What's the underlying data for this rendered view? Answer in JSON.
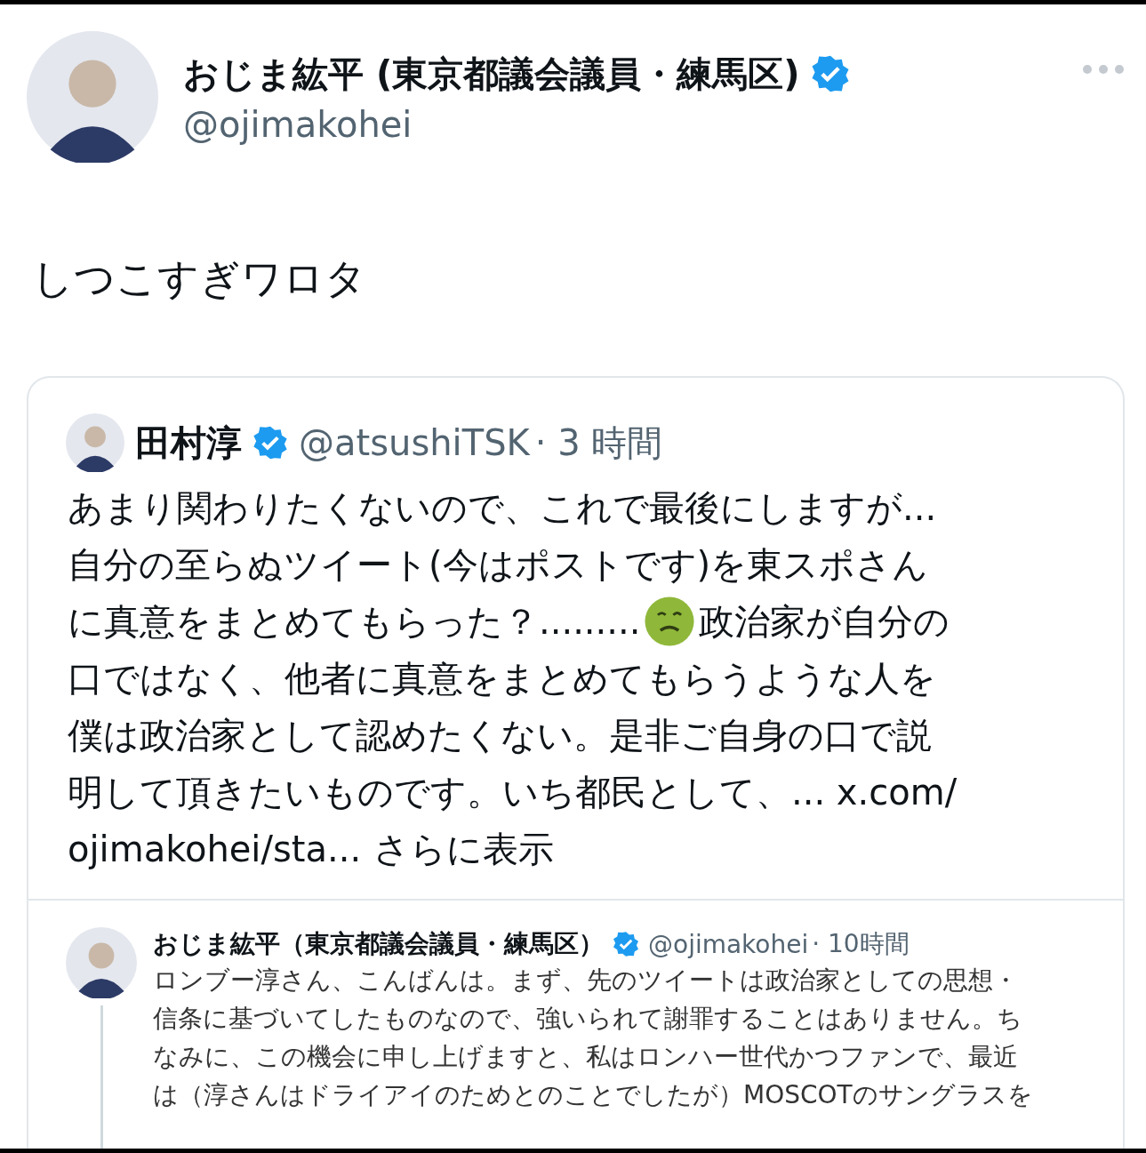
{
  "post": {
    "author": {
      "name": "おじま紘平 (東京都議会議員・練馬区)",
      "verified": true,
      "handle": "@ojimakohei"
    },
    "text": "しつこすぎワロタ"
  },
  "quote": {
    "author": {
      "name": "田村淳",
      "verified": true,
      "handle": "@atsushiTSK",
      "time": "· 3 時間"
    },
    "lines": [
      [
        {
          "kind": "text",
          "text": "あまり関わりたくないので、これで最後にしますが..."
        }
      ],
      [
        {
          "kind": "text",
          "text": "自分の至らぬツイート(今はポストです)を東スポさん"
        }
      ],
      [
        {
          "kind": "text",
          "text": "に真意をまとめてもらった？........."
        },
        {
          "kind": "emoji"
        },
        {
          "kind": "text",
          "text": "政治家が自分の"
        }
      ],
      [
        {
          "kind": "text",
          "text": "口ではなく、他者に真意をまとめてもらうような人を"
        }
      ],
      [
        {
          "kind": "text",
          "text": "僕は政治家として認めたくない。是非ご自身の口で説"
        }
      ],
      [
        {
          "kind": "text",
          "text": "明して頂きたいものです。いち都民として、... x.com/"
        }
      ],
      [
        {
          "kind": "text",
          "text": "ojimakohei/sta..."
        },
        {
          "kind": "text",
          "text": "さらに表示"
        }
      ]
    ],
    "nested": {
      "author": {
        "name": "おじま紘平（東京都議会議員・練馬区）",
        "verified": true,
        "handle": "@ojimakohei",
        "time": "· 10時間"
      },
      "lines": [
        "ロンブー淳さん、こんばんは。まず、先のツイートは政治家としての思想・",
        "信条に基づいてしたものなので、強いられて謝罪することはありません。ち",
        "なみに、この機会に申し上げますと、私はロンハー世代かつファンで、最近",
        "は（淳さんはドライアイのためとのことでしたが）MOSCOTのサングラスを"
      ]
    }
  }
}
